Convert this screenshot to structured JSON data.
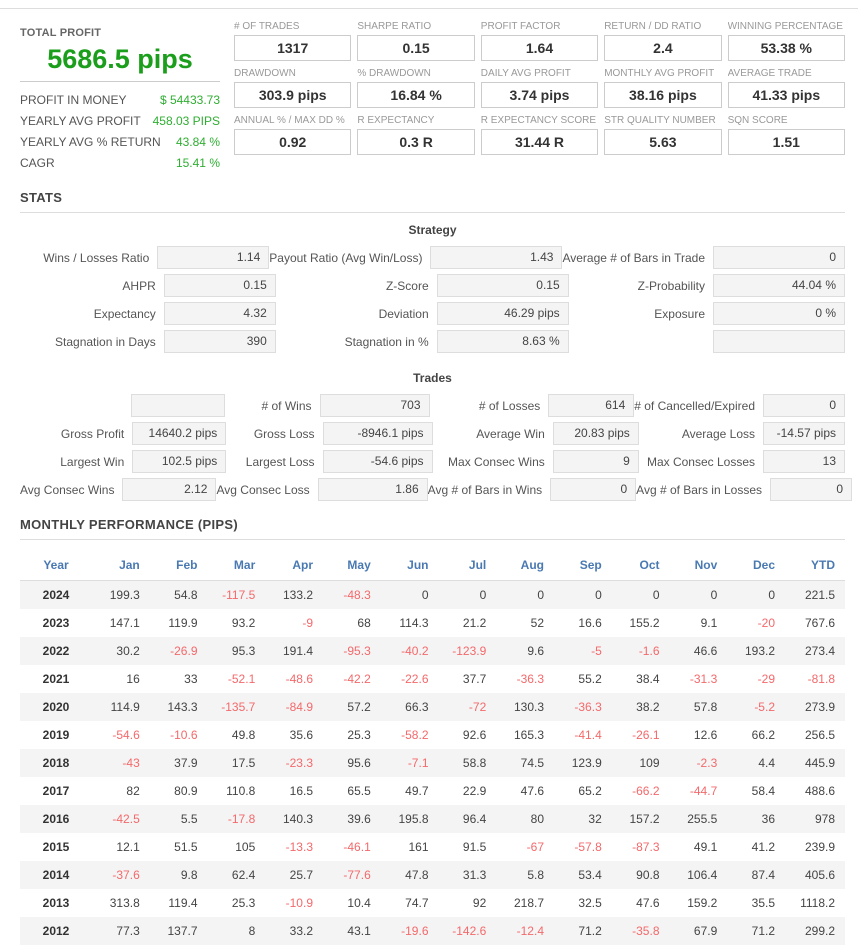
{
  "colors": {
    "green": "#1b9e1b",
    "light_green": "#2fae32",
    "red": "#f4696b",
    "blue": "#4a79b2"
  },
  "summary": {
    "total_profit_label": "TOTAL PROFIT",
    "total_profit_value": "5686.5 pips",
    "rows": [
      {
        "label": "PROFIT IN MONEY",
        "value": "$ 54433.73"
      },
      {
        "label": "YEARLY AVG PROFIT",
        "value": "458.03 PIPS"
      },
      {
        "label": "YEARLY AVG % RETURN",
        "value": "43.84 %"
      },
      {
        "label": "CAGR",
        "value": "15.41 %"
      }
    ]
  },
  "metrics": [
    {
      "label": "# OF TRADES",
      "value": "1317"
    },
    {
      "label": "SHARPE RATIO",
      "value": "0.15"
    },
    {
      "label": "PROFIT FACTOR",
      "value": "1.64"
    },
    {
      "label": "RETURN / DD RATIO",
      "value": "2.4"
    },
    {
      "label": "WINNING PERCENTAGE",
      "value": "53.38 %"
    },
    {
      "label": "DRAWDOWN",
      "value": "303.9 pips"
    },
    {
      "label": "% DRAWDOWN",
      "value": "16.84 %"
    },
    {
      "label": "DAILY AVG PROFIT",
      "value": "3.74 pips"
    },
    {
      "label": "MONTHLY AVG PROFIT",
      "value": "38.16 pips"
    },
    {
      "label": "AVERAGE TRADE",
      "value": "41.33 pips"
    },
    {
      "label": "ANNUAL % / MAX DD %",
      "value": "0.92"
    },
    {
      "label": "R EXPECTANCY",
      "value": "0.3 R"
    },
    {
      "label": "R EXPECTANCY SCORE",
      "value": "31.44 R"
    },
    {
      "label": "STR QUALITY NUMBER",
      "value": "5.63"
    },
    {
      "label": "SQN SCORE",
      "value": "1.51"
    }
  ],
  "stats": {
    "heading": "STATS",
    "strategy_title": "Strategy",
    "strategy_rows": [
      [
        {
          "label": "Wins / Losses Ratio",
          "value": "1.14"
        },
        {
          "label": "Payout Ratio (Avg Win/Loss)",
          "value": "1.43"
        },
        {
          "label": "Average # of Bars in Trade",
          "value": "0"
        }
      ],
      [
        {
          "label": "AHPR",
          "value": "0.15"
        },
        {
          "label": "Z-Score",
          "value": "0.15"
        },
        {
          "label": "Z-Probability",
          "value": "44.04 %"
        }
      ],
      [
        {
          "label": "Expectancy",
          "value": "4.32"
        },
        {
          "label": "Deviation",
          "value": "46.29 pips"
        },
        {
          "label": "Exposure",
          "value": "0 %"
        }
      ],
      [
        {
          "label": "Stagnation in Days",
          "value": "390"
        },
        {
          "label": "Stagnation in %",
          "value": "8.63 %"
        },
        {
          "label": "",
          "value": ""
        }
      ]
    ],
    "trades_title": "Trades",
    "trades_rows": [
      [
        {
          "label": "",
          "value": ""
        },
        {
          "label": "# of Wins",
          "value": "703"
        },
        {
          "label": "# of Losses",
          "value": "614"
        },
        {
          "label": "# of Cancelled/Expired",
          "value": "0"
        }
      ],
      [
        {
          "label": "Gross Profit",
          "value": "14640.2 pips"
        },
        {
          "label": "Gross Loss",
          "value": "-8946.1 pips"
        },
        {
          "label": "Average Win",
          "value": "20.83 pips"
        },
        {
          "label": "Average Loss",
          "value": "-14.57 pips"
        }
      ],
      [
        {
          "label": "Largest Win",
          "value": "102.5 pips"
        },
        {
          "label": "Largest Loss",
          "value": "-54.6 pips"
        },
        {
          "label": "Max Consec Wins",
          "value": "9"
        },
        {
          "label": "Max Consec Losses",
          "value": "13"
        }
      ],
      [
        {
          "label": "Avg Consec Wins",
          "value": "2.12"
        },
        {
          "label": "Avg Consec Loss",
          "value": "1.86"
        },
        {
          "label": "Avg # of Bars in Wins",
          "value": "0"
        },
        {
          "label": "Avg # of Bars in Losses",
          "value": "0"
        }
      ]
    ]
  },
  "monthly": {
    "heading": "MONTHLY PERFORMANCE (PIPS)",
    "columns": [
      "Year",
      "Jan",
      "Feb",
      "Mar",
      "Apr",
      "May",
      "Jun",
      "Jul",
      "Aug",
      "Sep",
      "Oct",
      "Nov",
      "Dec",
      "YTD"
    ],
    "rows": [
      {
        "year": "2024",
        "values": [
          199.3,
          54.8,
          -117.5,
          133.2,
          -48.3,
          0,
          0,
          0,
          0,
          0,
          0,
          0,
          221.5
        ]
      },
      {
        "year": "2023",
        "values": [
          147.1,
          119.9,
          93.2,
          -9,
          68,
          114.3,
          21.2,
          52,
          16.6,
          155.2,
          9.1,
          -20,
          767.6
        ]
      },
      {
        "year": "2022",
        "values": [
          30.2,
          -26.9,
          95.3,
          191.4,
          -95.3,
          -40.2,
          -123.9,
          9.6,
          -5,
          -1.6,
          46.6,
          193.2,
          273.4
        ]
      },
      {
        "year": "2021",
        "values": [
          16,
          33,
          -52.1,
          -48.6,
          -42.2,
          -22.6,
          37.7,
          -36.3,
          55.2,
          38.4,
          -31.3,
          -29,
          -81.8
        ]
      },
      {
        "year": "2020",
        "values": [
          114.9,
          143.3,
          -135.7,
          -84.9,
          57.2,
          66.3,
          -72,
          130.3,
          -36.3,
          38.2,
          57.8,
          -5.2,
          273.9
        ]
      },
      {
        "year": "2019",
        "values": [
          -54.6,
          -10.6,
          49.8,
          35.6,
          25.3,
          -58.2,
          92.6,
          165.3,
          -41.4,
          -26.1,
          12.6,
          66.2,
          256.5
        ]
      },
      {
        "year": "2018",
        "values": [
          -43,
          37.9,
          17.5,
          -23.3,
          95.6,
          -7.1,
          58.8,
          74.5,
          123.9,
          109,
          -2.3,
          4.4,
          445.9
        ]
      },
      {
        "year": "2017",
        "values": [
          82,
          80.9,
          110.8,
          16.5,
          65.5,
          49.7,
          22.9,
          47.6,
          65.2,
          -66.2,
          -44.7,
          58.4,
          488.6
        ]
      },
      {
        "year": "2016",
        "values": [
          -42.5,
          5.5,
          -17.8,
          140.3,
          39.6,
          195.8,
          96.4,
          80,
          32,
          157.2,
          255.5,
          36,
          978
        ]
      },
      {
        "year": "2015",
        "values": [
          12.1,
          51.5,
          105,
          -13.3,
          -46.1,
          161,
          91.5,
          -67,
          -57.8,
          -87.3,
          49.1,
          41.2,
          239.9
        ]
      },
      {
        "year": "2014",
        "values": [
          -37.6,
          9.8,
          62.4,
          25.7,
          -77.6,
          47.8,
          31.3,
          5.8,
          53.4,
          90.8,
          106.4,
          87.4,
          405.6
        ]
      },
      {
        "year": "2013",
        "values": [
          313.8,
          119.4,
          25.3,
          -10.9,
          10.4,
          74.7,
          92,
          218.7,
          32.5,
          47.6,
          159.2,
          35.5,
          1118.2
        ]
      },
      {
        "year": "2012",
        "values": [
          77.3,
          137.7,
          8,
          33.2,
          43.1,
          -19.6,
          -142.6,
          -12.4,
          71.2,
          -35.8,
          67.9,
          71.2,
          299.2
        ]
      }
    ]
  }
}
